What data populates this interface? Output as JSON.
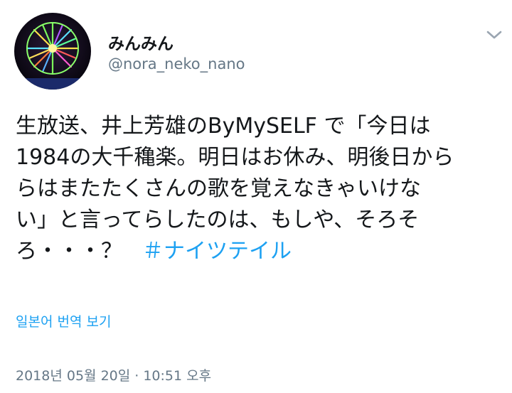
{
  "user": {
    "display_name": "みんみん",
    "handle": "@nora_neko_nano",
    "avatar_icon": "avatar-ferris-wheel-night"
  },
  "tweet": {
    "lines": [
      "生放送、井上芳雄のByMySELF で「今日は",
      "1984の大千穐楽。明日はお休み、明後日から",
      "らはまたたくさんの歌を覚えなきゃいけな",
      "い」と言ってらしたのは、もしや、そろそ",
      "ろ・・・？"
    ],
    "hashtag": "＃ナイツテイル"
  },
  "translate_label": "일본어 번역 보기",
  "timestamp": "2018년 05월 20일 · 10:51 오후",
  "colors": {
    "link": "#1da1f2",
    "secondary": "#657786",
    "text": "#14171a"
  },
  "icons": {
    "menu": "chevron-down-icon"
  }
}
